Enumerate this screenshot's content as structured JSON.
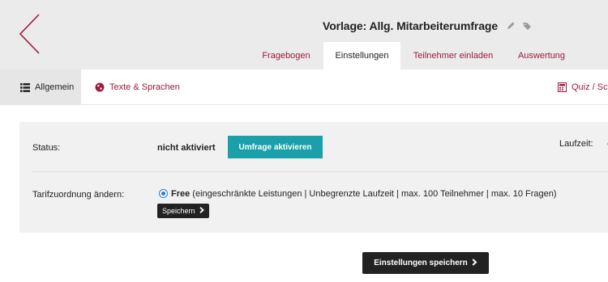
{
  "header": {
    "title": "Vorlage: Allg. Mitarbeiterumfrage",
    "tabs": [
      {
        "label": "Fragebogen",
        "active": false
      },
      {
        "label": "Einstellungen",
        "active": true
      },
      {
        "label": "Teilnehmer einladen",
        "active": false
      },
      {
        "label": "Auswertung",
        "active": false
      }
    ],
    "icons": [
      "back-chevron-icon",
      "pencil-icon",
      "tag-icon"
    ]
  },
  "subnav": {
    "items": [
      {
        "label": "Allgemein",
        "icon": "list-icon",
        "active": true
      },
      {
        "label": "Texte & Sprachen",
        "icon": "globe-icon",
        "active": false
      },
      {
        "label": "Quiz / Sc",
        "icon": "calculator-icon",
        "active": false
      }
    ]
  },
  "settings": {
    "status_label": "Status:",
    "status_value": "nicht aktiviert",
    "activate_button": "Umfrage aktivieren",
    "laufzeit_label": "Laufzeit:",
    "laufzeit_value": "-",
    "tarif_label": "Tarifzuordnung ändern:",
    "plan_name": "Free",
    "plan_details": " (eingeschränkte Leistungen | Unbegrenzte Laufzeit | max. 100 Teilnehmer | max. 10 Fragen)",
    "save_small_button": "Speichern"
  },
  "footer": {
    "save_settings_button": "Einstellungen speichern"
  },
  "colors": {
    "accent": "#9b1b3d",
    "teal": "#1aa0a8",
    "dark_button": "#222222",
    "header_bg": "#ebebeb",
    "panel_bg": "#f1f1f1"
  }
}
